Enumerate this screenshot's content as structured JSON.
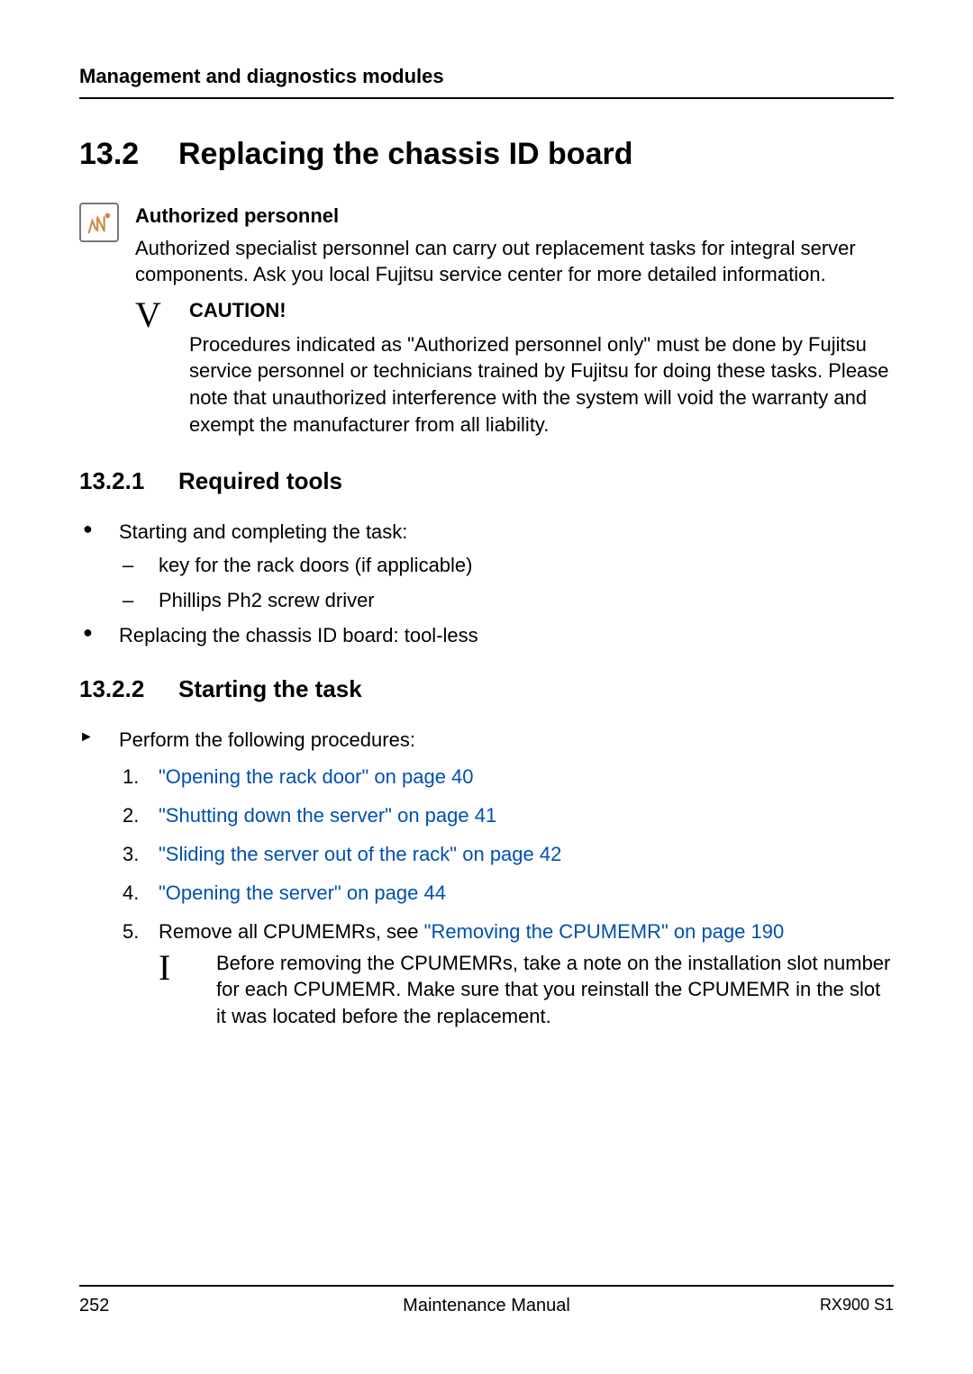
{
  "header": {
    "running": "Management and diagnostics modules"
  },
  "section": {
    "num": "13.2",
    "title": "Replacing the chassis ID board"
  },
  "authorized": {
    "title": "Authorized personnel",
    "body": "Authorized specialist personnel can carry out replacement tasks for integral server components. Ask you local Fujitsu service center for more detailed information."
  },
  "caution": {
    "letter": "V",
    "title": "CAUTION!",
    "body": "Procedures indicated as \"Authorized personnel only\" must be done by Fujitsu service personnel or technicians trained by Fujitsu for doing these tasks. Please note that unauthorized interference with the system will void the warranty and exempt the manufacturer from all liability."
  },
  "sub1": {
    "num": "13.2.1",
    "title": "Required tools",
    "items": [
      {
        "text": "Starting and completing the task:",
        "sub": [
          "key for the rack doors (if applicable)",
          "Phillips Ph2 screw driver"
        ]
      },
      {
        "text": "Replacing the chassis ID board: tool-less"
      }
    ]
  },
  "sub2": {
    "num": "13.2.2",
    "title": "Starting the task",
    "lead": "Perform the following procedures:",
    "steps": [
      {
        "link": "\"Opening the rack door\" on page 40"
      },
      {
        "link": "\"Shutting down the server\" on page 41"
      },
      {
        "link": "\"Sliding the server out of the rack\" on page 42"
      },
      {
        "link": "\"Opening the server\" on page 44"
      },
      {
        "pre": "Remove all CPUMEMRs, see ",
        "link": "\"Removing the CPUMEMR\" on page 190",
        "info": {
          "letter": "I",
          "text": "Before removing the CPUMEMRs, take a note on the installation slot number for each CPUMEMR. Make sure that you reinstall the CPUMEMR in the slot it was located before the replacement."
        }
      }
    ]
  },
  "footer": {
    "page": "252",
    "center": "Maintenance Manual",
    "right": "RX900 S1"
  }
}
